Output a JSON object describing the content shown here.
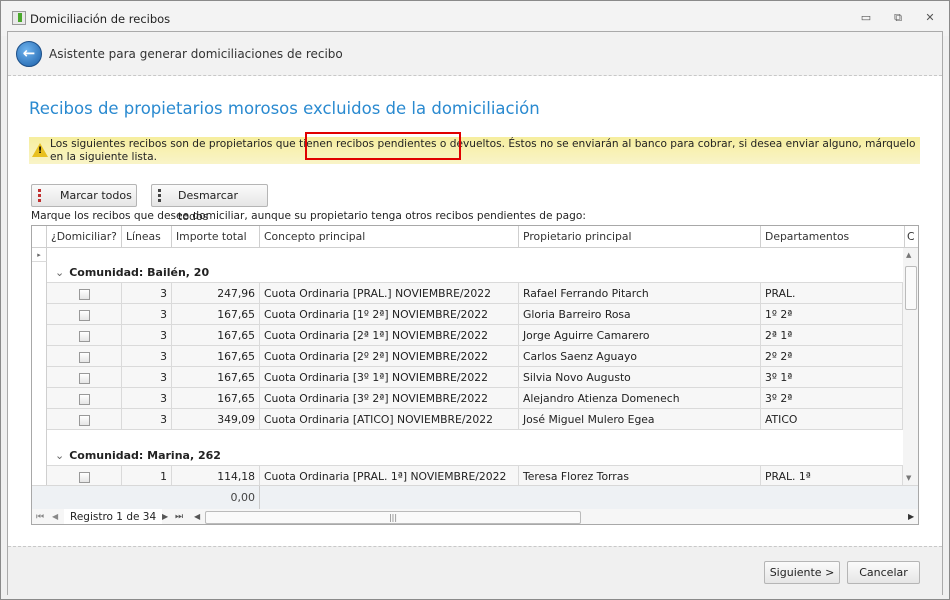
{
  "window": {
    "title": "Domiciliación de recibos",
    "minimize": "▭",
    "restore": "⧉",
    "close": "✕"
  },
  "header": {
    "title": "Asistente para generar domiciliaciones de recibo",
    "back_icon": "back-arrow-icon"
  },
  "page_title": "Recibos de propietarios morosos excluidos de la domiciliación",
  "warning": {
    "text": "Los siguientes recibos son de propietarios que tienen recibos pendientes o devueltos. Éstos no se enviarán al banco para cobrar, si desea enviar alguno, márquelo en la siguiente lista.",
    "icon": "!"
  },
  "buttons": {
    "mark_all": "Marcar todos",
    "unmark_all": "Desmarcar todos",
    "next": "Siguiente >",
    "cancel": "Cancelar"
  },
  "instructions": "Marque los recibos que desee domiciliar, aunque su propietario tenga otros recibos pendientes de pago:",
  "grid": {
    "columns": [
      "¿Domiciliar?",
      "Líneas",
      "Importe total",
      "Concepto principal",
      "Propietario principal",
      "Departamentos",
      "C"
    ],
    "groups": [
      {
        "label": "Comunidad: Bailén, 20",
        "rows": [
          {
            "lineas": "3",
            "importe": "247,96",
            "concepto": "Cuota Ordinaria [PRAL.] NOVIEMBRE/2022",
            "propietario": "Rafael Ferrando Pitarch",
            "dep": "PRAL."
          },
          {
            "lineas": "3",
            "importe": "167,65",
            "concepto": "Cuota Ordinaria [1º 2ª] NOVIEMBRE/2022",
            "propietario": "Gloria Barreiro Rosa",
            "dep": "1º 2ª"
          },
          {
            "lineas": "3",
            "importe": "167,65",
            "concepto": "Cuota Ordinaria [2ª 1ª] NOVIEMBRE/2022",
            "propietario": "Jorge Aguirre Camarero",
            "dep": "2ª 1ª"
          },
          {
            "lineas": "3",
            "importe": "167,65",
            "concepto": "Cuota Ordinaria [2º 2ª] NOVIEMBRE/2022",
            "propietario": "Carlos Saenz Aguayo",
            "dep": "2º 2ª"
          },
          {
            "lineas": "3",
            "importe": "167,65",
            "concepto": "Cuota Ordinaria [3º 1ª] NOVIEMBRE/2022",
            "propietario": "Silvia Novo Augusto",
            "dep": "3º 1ª"
          },
          {
            "lineas": "3",
            "importe": "167,65",
            "concepto": "Cuota Ordinaria [3º 2ª] NOVIEMBRE/2022",
            "propietario": "Alejandro Atienza Domenech",
            "dep": "3º 2ª"
          },
          {
            "lineas": "3",
            "importe": "349,09",
            "concepto": "Cuota Ordinaria [ATICO] NOVIEMBRE/2022",
            "propietario": "José Miguel Mulero Egea",
            "dep": "ATICO"
          }
        ]
      },
      {
        "label": "Comunidad: Marina, 262",
        "rows": [
          {
            "lineas": "1",
            "importe": "114,18",
            "concepto": "Cuota Ordinaria [PRAL. 1ª] NOVIEMBRE/2022",
            "propietario": "Teresa Florez Torras",
            "dep": "PRAL. 1ª"
          }
        ]
      }
    ],
    "total": "0,00",
    "record": "Registro 1 de 34"
  }
}
